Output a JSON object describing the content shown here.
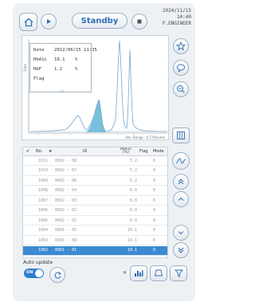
{
  "header": {
    "status": "Standby",
    "date": "2024/11/15",
    "time": "14:40",
    "user": "F.ENGINEER"
  },
  "info": {
    "date_label": "Date",
    "date_value": "2022/06/15 11:35",
    "hba1c_label": "HbA1c",
    "hba1c_value": "10.1",
    "hba1c_unit": "%",
    "hbf_label": "HbF",
    "hbf_value": "1.2",
    "hbf_unit": "%",
    "flag_label": "Flag",
    "flag_value": ""
  },
  "chart": {
    "ylabel": "Data",
    "xlabel": "Abs. Range : 0.2 Minutes",
    "accent": "#5fb6d6"
  },
  "table": {
    "headers": {
      "check": "✔",
      "no": "No.",
      "star": "★",
      "id": "ID",
      "hba1c": "HbA1c",
      "hba1c_unit": "[%]",
      "flag": "Flag",
      "mode": "Mode"
    },
    "rows": [
      {
        "no": "1011",
        "id": "0002 - 08",
        "hba1c": "5.2",
        "flag": "",
        "mode": "0"
      },
      {
        "no": "1010",
        "id": "0002 - 07",
        "hba1c": "5.2",
        "flag": "",
        "mode": "0"
      },
      {
        "no": "1009",
        "id": "0002 - 06",
        "hba1c": "5.2",
        "flag": "",
        "mode": "0"
      },
      {
        "no": "1008",
        "id": "0002 - 04",
        "hba1c": "8.0",
        "flag": "",
        "mode": "0"
      },
      {
        "no": "1007",
        "id": "0002 - 03",
        "hba1c": "8.0",
        "flag": "",
        "mode": "0"
      },
      {
        "no": "1006",
        "id": "0002 - 02",
        "hba1c": "8.0",
        "flag": "",
        "mode": "0"
      },
      {
        "no": "1005",
        "id": "0002 - 01",
        "hba1c": "8.0",
        "flag": "",
        "mode": "0"
      },
      {
        "no": "1004",
        "id": "0001 - 05",
        "hba1c": "10.1",
        "flag": "",
        "mode": "0"
      },
      {
        "no": "1003",
        "id": "0001 - 08",
        "hba1c": "10.1",
        "flag": "",
        "mode": "0"
      },
      {
        "no": "1002",
        "id": "0001 - 01",
        "hba1c": "10.1",
        "flag": "",
        "mode": "0"
      }
    ],
    "selected_index": 9
  },
  "footer": {
    "auto_update_label": "Auto update",
    "toggle_label": "ON",
    "chevrons": "»"
  },
  "colors": {
    "primary": "#2f7fd0",
    "status_text": "#2f6fb5",
    "selected_row": "#3c8ad2"
  }
}
